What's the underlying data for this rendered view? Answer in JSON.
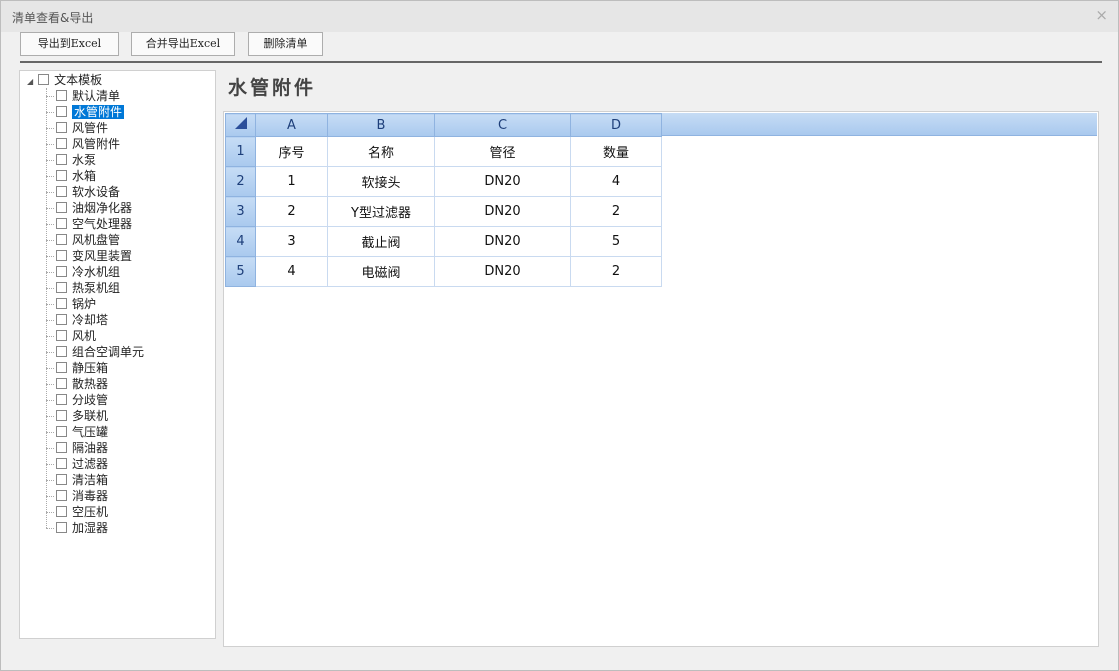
{
  "window": {
    "title": "清单查看&导出",
    "close": "×"
  },
  "toolbar": {
    "export": "导出到Excel",
    "merge": "合并导出Excel",
    "delete": "删除清单"
  },
  "tree": {
    "root": "文本模板",
    "items": [
      "默认清单",
      "水管附件",
      "风管件",
      "风管附件",
      "水泵",
      "水箱",
      "软水设备",
      "油烟净化器",
      "空气处理器",
      "风机盘管",
      "变风里装置",
      "冷水机组",
      "热泵机组",
      "锅炉",
      "冷却塔",
      "风机",
      "组合空调单元",
      "静压箱",
      "散热器",
      "分歧管",
      "多联机",
      "气压罐",
      "隔油器",
      "过滤器",
      "清洁箱",
      "消毒器",
      "空压机",
      "加湿器"
    ],
    "selected": 1
  },
  "sheet": {
    "title": "水管附件",
    "columns": [
      "A",
      "B",
      "C",
      "D"
    ],
    "rows": [
      [
        "序号",
        "名称",
        "管径",
        "数量"
      ],
      [
        "1",
        "软接头",
        "DN20",
        "4"
      ],
      [
        "2",
        "Y型过滤器",
        "DN20",
        "2"
      ],
      [
        "3",
        "截止阀",
        "DN20",
        "5"
      ],
      [
        "4",
        "电磁阀",
        "DN20",
        "2"
      ]
    ]
  }
}
